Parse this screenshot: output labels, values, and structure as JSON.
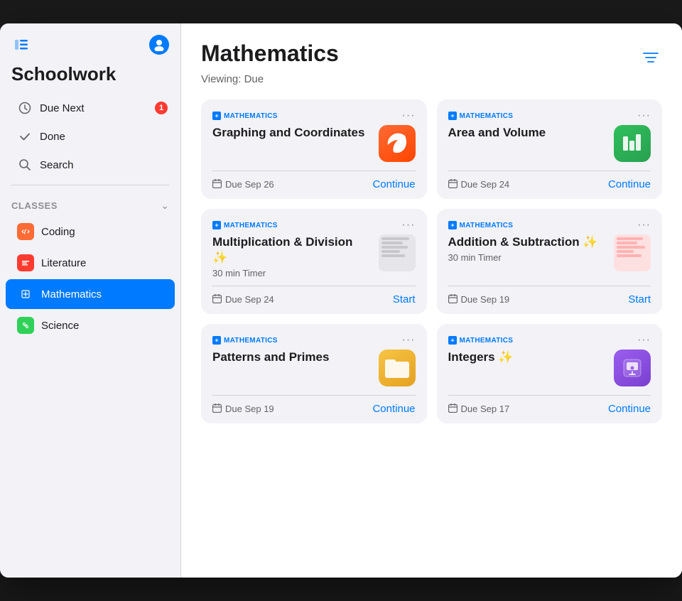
{
  "app": {
    "title": "Schoolwork",
    "window_icon": "sidebar-left"
  },
  "sidebar": {
    "title": "Schoolwork",
    "nav_items": [
      {
        "id": "due-next",
        "label": "Due Next",
        "icon": "clock",
        "badge": "1"
      },
      {
        "id": "done",
        "label": "Done",
        "icon": "checkmark"
      },
      {
        "id": "search",
        "label": "Search",
        "icon": "search"
      }
    ],
    "classes_section": "Classes",
    "classes": [
      {
        "id": "coding",
        "label": "Coding",
        "color": "#ff6b35",
        "icon": "🟧"
      },
      {
        "id": "literature",
        "label": "Literature",
        "color": "#ff3b30",
        "icon": "📊"
      },
      {
        "id": "mathematics",
        "label": "Mathematics",
        "color": "#007aff",
        "icon": "🗓",
        "active": true
      },
      {
        "id": "science",
        "label": "Science",
        "color": "#30d158",
        "icon": "🔬"
      }
    ]
  },
  "main": {
    "title": "Mathematics",
    "viewing_label": "Viewing: Due",
    "filter_icon": "filter",
    "cards": [
      {
        "id": "graphing-coordinates",
        "subject": "MATHEMATICS",
        "title": "Graphing and Coordinates",
        "subtitle": "",
        "app_icon": "swift",
        "due": "Due Sep 26",
        "action": "Continue"
      },
      {
        "id": "area-volume",
        "subject": "MATHEMATICS",
        "title": "Area and Volume",
        "subtitle": "",
        "app_icon": "numbers",
        "due": "Due Sep 24",
        "action": "Continue"
      },
      {
        "id": "multiplication-division",
        "subject": "MATHEMATICS",
        "title": "Multiplication & Division ✨",
        "subtitle": "30 min Timer",
        "app_icon": "thumbnail",
        "due": "Due Sep 24",
        "action": "Start"
      },
      {
        "id": "addition-subtraction",
        "subject": "MATHEMATICS",
        "title": "Addition & Subtraction ✨",
        "subtitle": "30 min Timer",
        "app_icon": "thumbnail2",
        "due": "Due Sep 19",
        "action": "Start"
      },
      {
        "id": "patterns-primes",
        "subject": "MATHEMATICS",
        "title": "Patterns and Primes",
        "subtitle": "",
        "app_icon": "folder",
        "due": "Due Sep 19",
        "action": "Continue"
      },
      {
        "id": "integers",
        "subject": "MATHEMATICS",
        "title": "Integers ✨",
        "subtitle": "",
        "app_icon": "keynote",
        "due": "Due Sep 17",
        "action": "Continue"
      }
    ]
  }
}
